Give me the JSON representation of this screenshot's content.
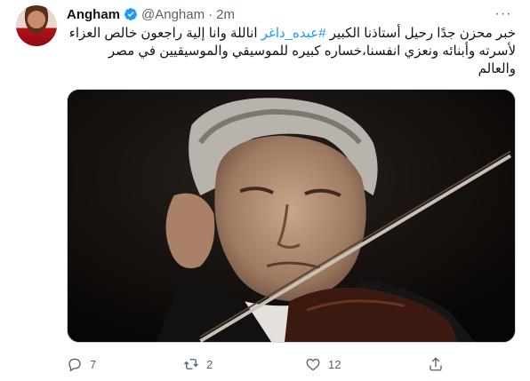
{
  "tweet": {
    "author_name": "Angham",
    "handle": "@Angham",
    "separator": "·",
    "time": "2m",
    "more_label": "···",
    "text_line1_pre": "خبر محزن جدًا رحيل أستاذنا الكبير ",
    "hashtag": "#عبده_داغر",
    "text_line1_post": " اناللة وانا إلية راجعون خالص العزاء",
    "text_line2": "لأسرته وأبنائه ونعزي انفسنا،خساره كبيره للموسيقي والموسيقيين في مصر",
    "text_line3": "والعالم"
  },
  "actions": {
    "reply_count": "7",
    "retweet_count": "2",
    "like_count": "12"
  },
  "colors": {
    "accent": "#1d9bf0",
    "secondary_text": "#536471"
  },
  "icons": [
    "verified-icon",
    "more-icon",
    "reply-icon",
    "retweet-icon",
    "like-icon",
    "share-icon"
  ]
}
